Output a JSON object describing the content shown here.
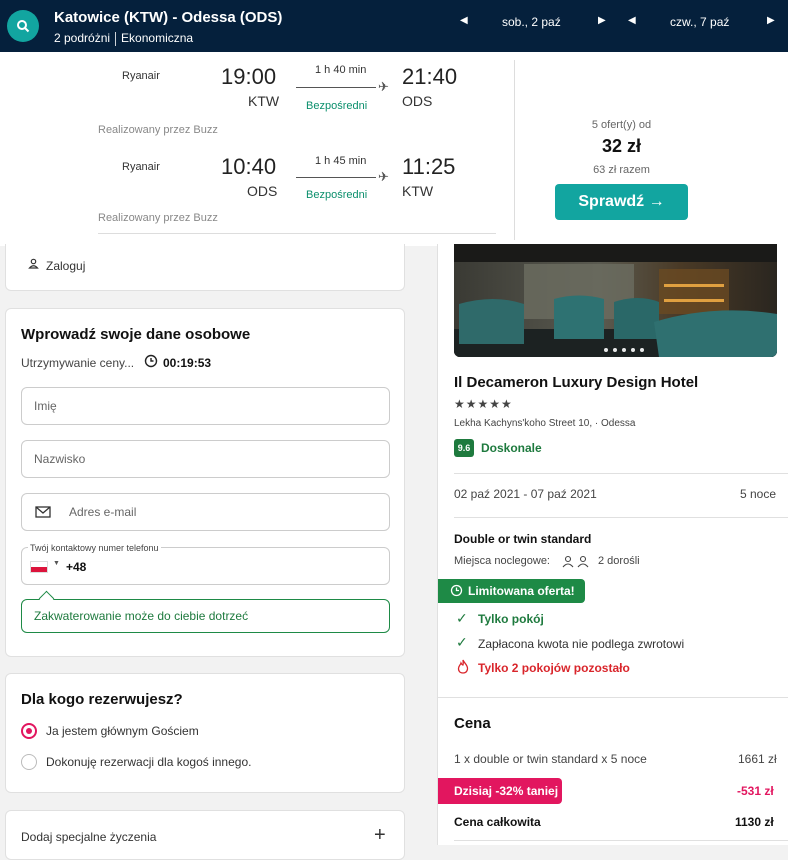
{
  "header": {
    "route": "Katowice (KTW) - Odessa (ODS)",
    "travellers": "2 podróżni",
    "cabin": "Ekonomiczna",
    "depart_date": "sob., 2 paź",
    "return_date": "czw., 7 paź"
  },
  "flight": {
    "outbound": {
      "airline": "Ryanair",
      "dep_time": "19:00",
      "dep_code": "KTW",
      "duration": "1 h 40 min",
      "stops": "Bezpośredni",
      "arr_time": "21:40",
      "arr_code": "ODS",
      "operated": "Realizowany przez Buzz"
    },
    "inbound": {
      "airline": "Ryanair",
      "dep_time": "10:40",
      "dep_code": "ODS",
      "duration": "1 h 45 min",
      "stops": "Bezpośredni",
      "arr_time": "11:25",
      "arr_code": "KTW",
      "operated": "Realizowany przez Buzz"
    },
    "offers": "5 ofert(y) od",
    "price": "32 zł",
    "total": "63 zł razem",
    "check_label": "Sprawdź →"
  },
  "login": {
    "label": "Zaloguj"
  },
  "personal": {
    "title": "Wprowadź swoje dane osobowe",
    "hold_label": "Utrzymywanie ceny...",
    "timer": "00:19:53",
    "first_name_placeholder": "Imię",
    "last_name_placeholder": "Nazwisko",
    "email_placeholder": "Adres e-mail",
    "phone_label": "Twój kontaktowy numer telefonu",
    "phone_prefix": "+48",
    "tip": "Zakwaterowanie może do ciebie dotrzeć"
  },
  "who": {
    "title": "Dla kogo rezerwujesz?",
    "option_main": "Ja jestem głównym Gościem",
    "option_other": "Dokonuję rezerwacji dla kogoś innego."
  },
  "special": {
    "label": "Dodaj specjalne życzenia",
    "plus": "+"
  },
  "hotel": {
    "name": "Il Decameron Luxury Design Hotel",
    "stars": "★★★★★",
    "address": "Lekha Kachyns'koho Street 10, · Odessa",
    "score": "9.6",
    "score_text": "Doskonale",
    "dates": "02 paź 2021 - 07 paź 2021",
    "nights": "5 noce",
    "room": "Double or twin standard",
    "beds_label": "Miejsca noclegowe:",
    "guests": "2 dorośli",
    "limited": "Limitowana oferta!",
    "features": [
      "Tylko pokój",
      "Zapłacona kwota nie podlega zwrotowi"
    ],
    "rooms_left": "Tylko 2 pokojów pozostało"
  },
  "price": {
    "title": "Cena",
    "line_item": "1 x double or twin standard x 5 noce",
    "line_price": "1661 zł",
    "discount_label": "Dzisiaj -32% taniej",
    "discount_value": "-531 zł",
    "total_label": "Cena całkowita",
    "total_value": "1130 zł"
  },
  "colors": {
    "header": "#05203c",
    "teal": "#12a5a0",
    "green": "#1e8a46",
    "pink": "#e2165f"
  }
}
